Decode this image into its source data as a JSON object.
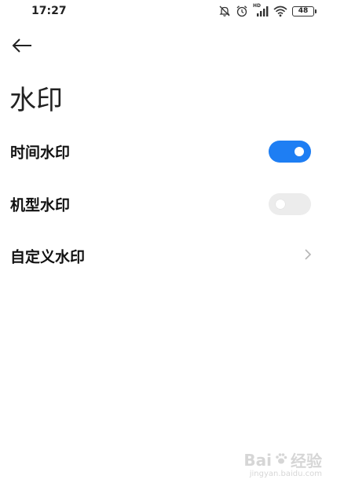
{
  "status_bar": {
    "time": "17:27",
    "battery": "48",
    "signal_label": "HD",
    "icons": [
      "mute-icon",
      "alarm-icon",
      "signal-icon",
      "wifi-icon",
      "battery-icon"
    ]
  },
  "header": {
    "back_icon": "back-arrow-icon",
    "title": "水印"
  },
  "settings": {
    "time_watermark": {
      "label": "时间水印",
      "enabled": true
    },
    "device_watermark": {
      "label": "机型水印",
      "enabled": false
    },
    "custom_watermark": {
      "label": "自定义水印",
      "icon": "chevron-right-icon"
    }
  },
  "colors": {
    "accent": "#1e7ef3",
    "toggle_off": "#ececec"
  },
  "watermark": {
    "logo_left": "Bai",
    "logo_right": "经验",
    "url": "jingyan.baidu.com"
  }
}
